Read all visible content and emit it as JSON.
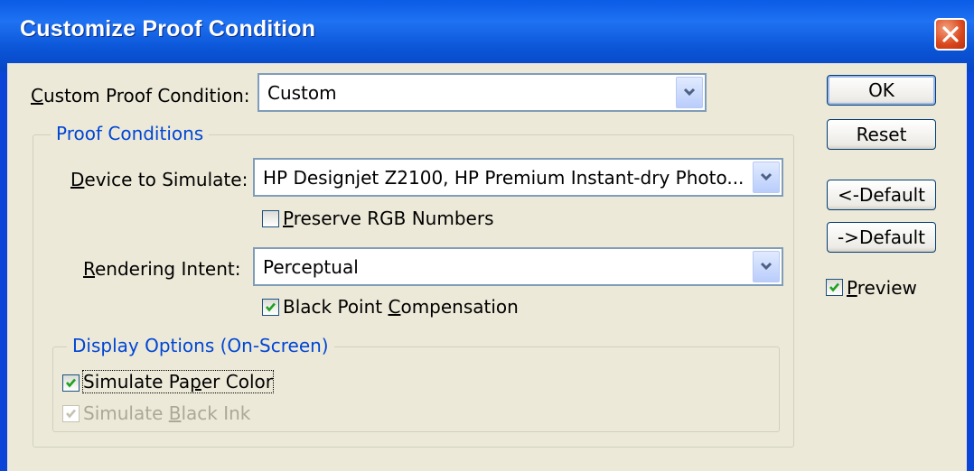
{
  "window": {
    "title": "Customize Proof Condition"
  },
  "custom_proof": {
    "label_pre": "",
    "label_u": "C",
    "label_post": "ustom Proof Condition:",
    "value": "Custom"
  },
  "proof_conditions": {
    "legend": "Proof Conditions",
    "device": {
      "label_u": "D",
      "label_post": "evice to Simulate:",
      "value": "HP Designjet Z2100, HP Premium Instant-dry Photo..."
    },
    "preserve_rgb": {
      "label_u": "P",
      "label_post": "reserve RGB Numbers",
      "checked": false
    },
    "rendering": {
      "label_u": "R",
      "label_post": "endering Intent:",
      "value": "Perceptual"
    },
    "bpc": {
      "label_pre": "Black Point ",
      "label_u": "C",
      "label_post": "ompensation",
      "checked": true
    }
  },
  "display_options": {
    "legend": "Display Options (On-Screen)",
    "paper": {
      "label_pre": "Simulate Pa",
      "label_u": "p",
      "label_post": "er Color",
      "checked": true
    },
    "black_ink": {
      "label_pre": "Simulate ",
      "label_u": "B",
      "label_post": "lack Ink",
      "checked": true,
      "disabled": true
    }
  },
  "buttons": {
    "ok": "OK",
    "reset": "Reset",
    "prev_default": "<-Default",
    "next_default": "->Default"
  },
  "preview": {
    "label_u": "P",
    "label_post": "review",
    "checked": true
  },
  "colors": {
    "title_bar": "#0a54d6",
    "dialog_bg": "#ece9d8",
    "group_label": "#0046d5",
    "close_button": "#d9461c"
  }
}
